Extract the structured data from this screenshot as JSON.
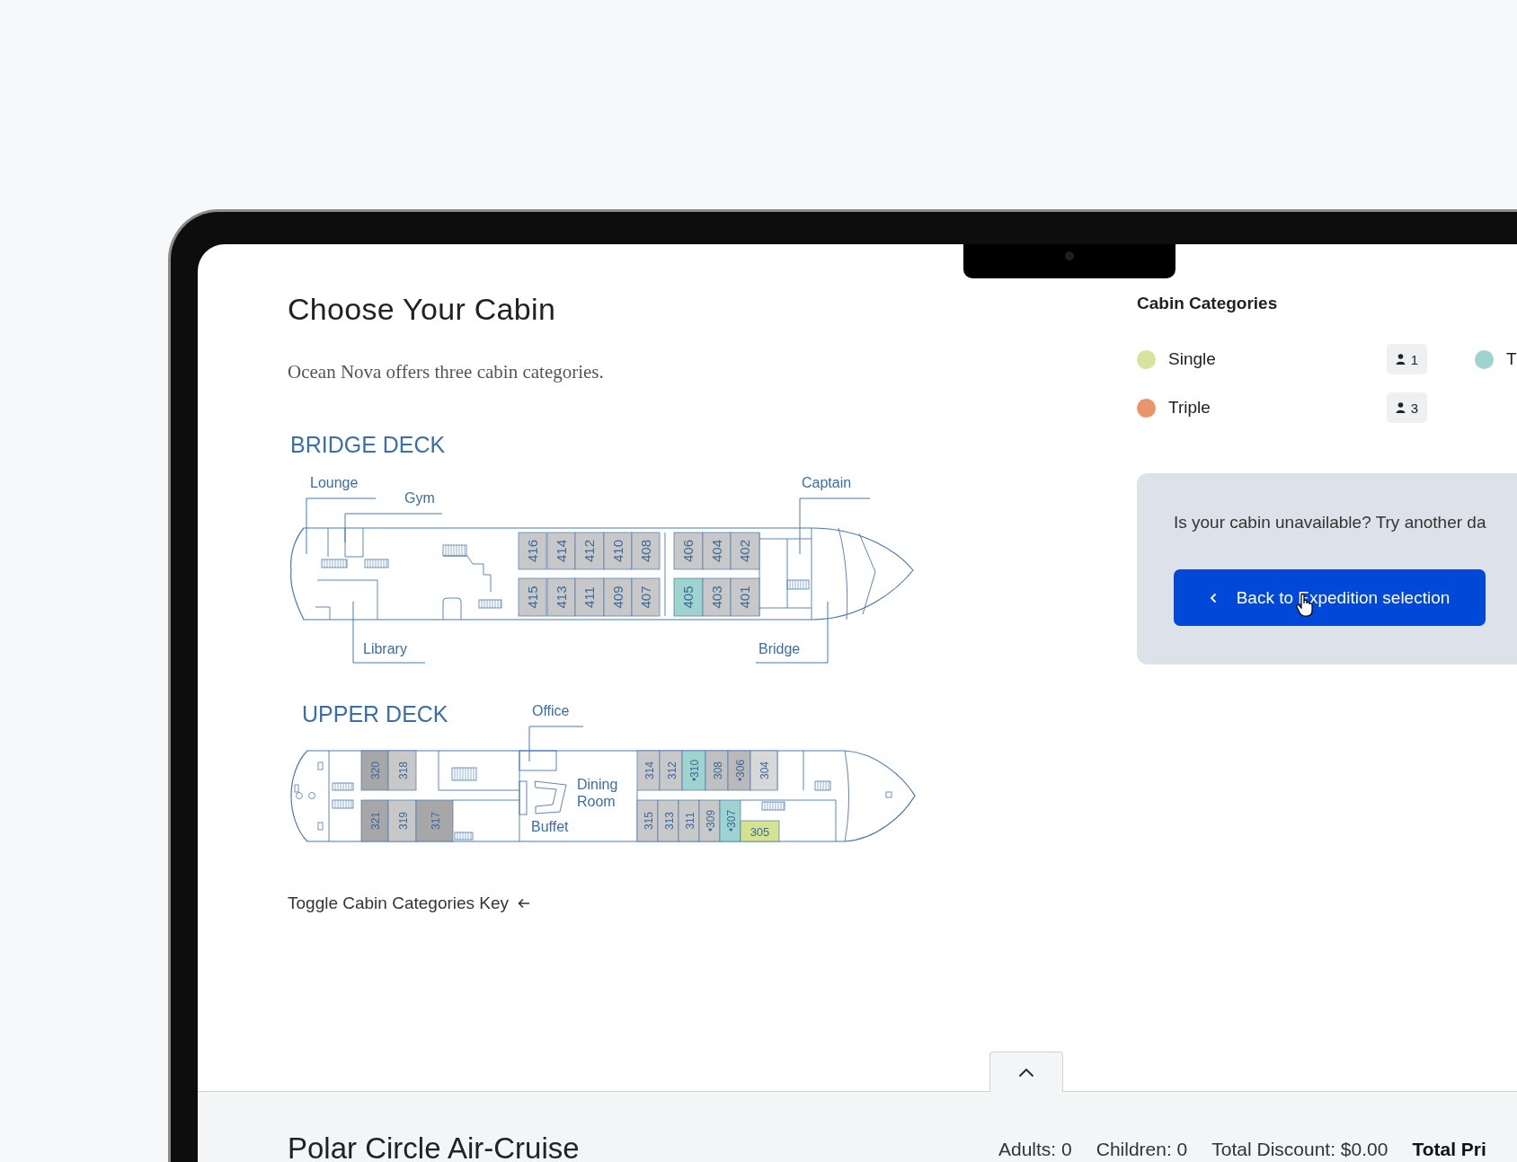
{
  "page": {
    "title": "Choose Your Cabin",
    "description": "Ocean Nova offers three cabin categories.",
    "toggle_link": "Toggle Cabin Categories Key"
  },
  "decks": [
    {
      "name": "BRIDGE DECK",
      "rooms": [
        "Lounge",
        "Gym",
        "Library",
        "Captain",
        "Bridge"
      ],
      "cabins": [
        {
          "number": "416",
          "color": "#c8c8c9"
        },
        {
          "number": "414",
          "color": "#c8c8c9"
        },
        {
          "number": "412",
          "color": "#c8c8c9"
        },
        {
          "number": "410",
          "color": "#c8c8c9"
        },
        {
          "number": "408",
          "color": "#c8c8c9"
        },
        {
          "number": "406",
          "color": "#c8c8c9"
        },
        {
          "number": "404",
          "color": "#c8c8c9"
        },
        {
          "number": "402",
          "color": "#c8c8c9"
        },
        {
          "number": "415",
          "color": "#c8c8c9"
        },
        {
          "number": "413",
          "color": "#c8c8c9"
        },
        {
          "number": "411",
          "color": "#c8c8c9"
        },
        {
          "number": "409",
          "color": "#c8c8c9"
        },
        {
          "number": "407",
          "color": "#c8c8c9"
        },
        {
          "number": "405",
          "color": "#9fd3cf"
        },
        {
          "number": "403",
          "color": "#c8c8c9"
        },
        {
          "number": "401",
          "color": "#c8c8c9"
        }
      ]
    },
    {
      "name": "UPPER DECK",
      "rooms": [
        "Office",
        "Dining Room",
        "Buffet"
      ],
      "cabins": [
        {
          "number": "320",
          "color": "#a7a7a8"
        },
        {
          "number": "318",
          "color": "#c8c8c9"
        },
        {
          "number": "314",
          "color": "#c8c8c9"
        },
        {
          "number": "312",
          "color": "#c8c8c9"
        },
        {
          "number": "•310",
          "color": "#9fd3cf"
        },
        {
          "number": "308",
          "color": "#c0c0c1"
        },
        {
          "number": "•306",
          "color": "#b9b9ba"
        },
        {
          "number": "304",
          "color": "#d8d8d9"
        },
        {
          "number": "321",
          "color": "#a7a7a8"
        },
        {
          "number": "319",
          "color": "#c8c8c9"
        },
        {
          "number": "317",
          "color": "#a7a7a8"
        },
        {
          "number": "315",
          "color": "#c8c8c9"
        },
        {
          "number": "313",
          "color": "#c8c8c9"
        },
        {
          "number": "311",
          "color": "#c8c8c9"
        },
        {
          "number": "•309",
          "color": "#c8c8c9"
        },
        {
          "number": "•307",
          "color": "#9fd3cf"
        },
        {
          "number": "305",
          "color": "#d6e28e"
        }
      ]
    }
  ],
  "categories": {
    "title": "Cabin Categories",
    "items": [
      {
        "label": "Single",
        "color": "#d6e39c",
        "count": "1"
      },
      {
        "label": "T",
        "color": "#9fd3cf"
      },
      {
        "label": "Triple",
        "color": "#e9956a",
        "count": "3"
      }
    ]
  },
  "availability": {
    "text": "Is your cabin unavailable? Try another da",
    "button": "Back to Expedition selection"
  },
  "footer": {
    "trip": "Polar Circle Air-Cruise",
    "summary": [
      {
        "text": "Adults: 0",
        "kind": "count"
      },
      {
        "text": "Children: 0",
        "kind": "count"
      },
      {
        "text": "Total Discount: $0.00",
        "kind": "count"
      },
      {
        "text": "Total Pri",
        "kind": "total"
      }
    ]
  }
}
